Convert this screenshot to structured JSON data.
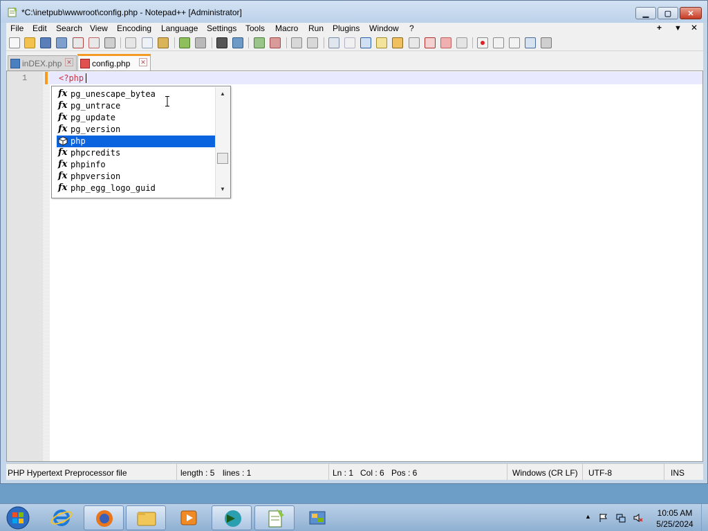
{
  "window": {
    "title": "*C:\\inetpub\\wwwroot\\config.php - Notepad++ [Administrator]",
    "minimize_glyph": "▁",
    "maximize_glyph": "▢",
    "close_glyph": "✕"
  },
  "menu": {
    "items": [
      "File",
      "Edit",
      "Search",
      "View",
      "Encoding",
      "Language",
      "Settings",
      "Tools",
      "Macro",
      "Run",
      "Plugins",
      "Window",
      "?"
    ],
    "right_plus": "+",
    "right_down": "▼",
    "right_close": "✕"
  },
  "toolbar": {
    "icons": [
      "new-file-icon",
      "open-file-icon",
      "save-icon",
      "save-all-icon",
      "close-icon",
      "close-all-icon",
      "print-icon",
      "cut-icon",
      "copy-icon",
      "paste-icon",
      "undo-icon",
      "redo-icon",
      "find-icon",
      "replace-icon",
      "zoom-in-icon",
      "zoom-out-icon",
      "sync-vertical-icon",
      "sync-horizontal-icon",
      "word-wrap-icon",
      "show-all-chars-icon",
      "indent-guide-icon",
      "user-language-icon",
      "doc-map-icon",
      "function-list-icon",
      "folder-as-workspace-icon",
      "monitoring-icon",
      "record-macro-icon",
      "stop-macro-icon",
      "play-macro-icon",
      "run-macro-multiple-icon",
      "save-macro-icon"
    ]
  },
  "tabs": [
    {
      "label": "inDEX.php",
      "active": false
    },
    {
      "label": "config.php",
      "active": true
    }
  ],
  "editor": {
    "line_number": "1",
    "code": "<?php"
  },
  "autocomplete": {
    "items": [
      {
        "label": "pg_unescape_bytea",
        "icon": "function-icon",
        "selected": false
      },
      {
        "label": "pg_untrace",
        "icon": "function-icon",
        "selected": false
      },
      {
        "label": "pg_update",
        "icon": "function-icon",
        "selected": false
      },
      {
        "label": "pg_version",
        "icon": "function-icon",
        "selected": false
      },
      {
        "label": "php",
        "icon": "keyword-cube-icon",
        "selected": true
      },
      {
        "label": "phpcredits",
        "icon": "function-icon",
        "selected": false
      },
      {
        "label": "phpinfo",
        "icon": "function-icon",
        "selected": false
      },
      {
        "label": "phpversion",
        "icon": "function-icon",
        "selected": false
      },
      {
        "label": "php_egg_logo_guid",
        "icon": "function-icon",
        "selected": false
      }
    ],
    "function_glyph": "fx",
    "scroll_up": "▲",
    "scroll_down": "▼"
  },
  "status": {
    "file_type": "PHP Hypertext Preprocessor file",
    "length": "length : 5",
    "lines": "lines : 1",
    "ln": "Ln : 1",
    "col": "Col : 6",
    "pos": "Pos : 6",
    "eol": "Windows (CR LF)",
    "encoding": "UTF-8",
    "mode": "INS"
  },
  "taskbar": {
    "apps": [
      "internet-explorer-icon",
      "firefox-icon",
      "file-explorer-icon",
      "media-player-icon",
      "app-icon",
      "notepadpp-icon",
      "network-app-icon"
    ],
    "time": "10:05 AM",
    "date": "5/25/2024"
  },
  "colors": {
    "accent_orange": "#f59a23",
    "selection_blue": "#0a64e0",
    "php_tag_red": "#d1323a"
  }
}
